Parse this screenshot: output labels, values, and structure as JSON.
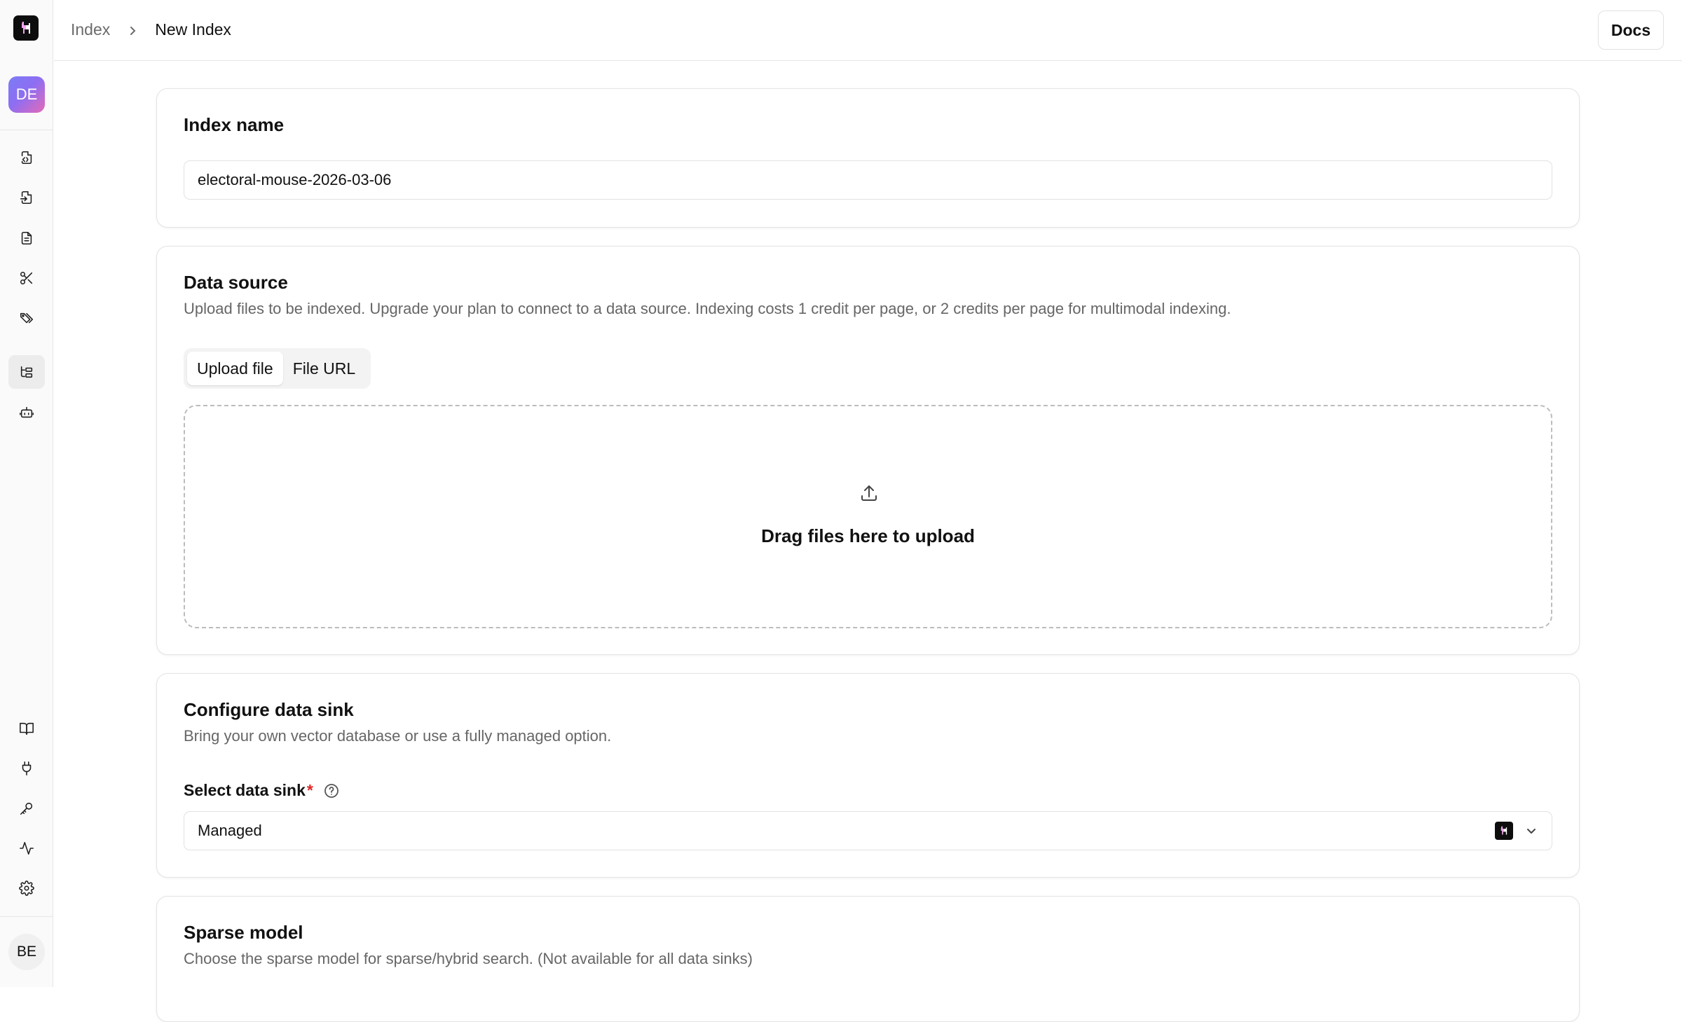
{
  "sidebar": {
    "logo_icon": "llama-logo-icon",
    "workspace_avatar": "DE",
    "user_avatar": "BE",
    "items": [
      {
        "id": "parse",
        "icon": "file-code-icon",
        "active": false
      },
      {
        "id": "extract",
        "icon": "file-import-icon",
        "active": false
      },
      {
        "id": "documents",
        "icon": "file-text-icon",
        "active": false
      },
      {
        "id": "split",
        "icon": "scissors-icon",
        "active": false
      },
      {
        "id": "classify",
        "icon": "tags-icon",
        "active": false
      },
      {
        "id": "index",
        "icon": "tree-list-icon",
        "active": true
      },
      {
        "id": "agents",
        "icon": "bot-icon",
        "active": false
      }
    ],
    "bottom_items": [
      {
        "id": "docs",
        "icon": "book-open-icon"
      },
      {
        "id": "integrations",
        "icon": "plug-icon"
      },
      {
        "id": "api-keys",
        "icon": "key-icon"
      },
      {
        "id": "activity",
        "icon": "activity-icon"
      },
      {
        "id": "settings",
        "icon": "gear-icon"
      }
    ]
  },
  "header": {
    "breadcrumb": {
      "parent": "Index",
      "current": "New Index"
    },
    "docs_label": "Docs"
  },
  "index_name": {
    "title": "Index name",
    "value": "electoral-mouse-2026-03-06"
  },
  "data_source": {
    "title": "Data source",
    "description": "Upload files to be indexed. Upgrade your plan to connect to a data source. Indexing costs 1 credit per page, or 2 credits per page for multimodal indexing.",
    "tabs": [
      {
        "label": "Upload file",
        "active": true
      },
      {
        "label": "File URL",
        "active": false
      }
    ],
    "dropzone_text": "Drag files here to upload"
  },
  "data_sink": {
    "title": "Configure data sink",
    "description": "Bring your own vector database or use a fully managed option.",
    "select_label": "Select data sink",
    "required_mark": "*",
    "selected_value": "Managed"
  },
  "sparse_model": {
    "title": "Sparse model",
    "description": "Choose the sparse model for sparse/hybrid search. (Not available for all data sinks)"
  },
  "colors": {
    "required": "#dc2626",
    "workspace_gradient": [
      "#7c7cf5",
      "#e46ab8"
    ]
  }
}
